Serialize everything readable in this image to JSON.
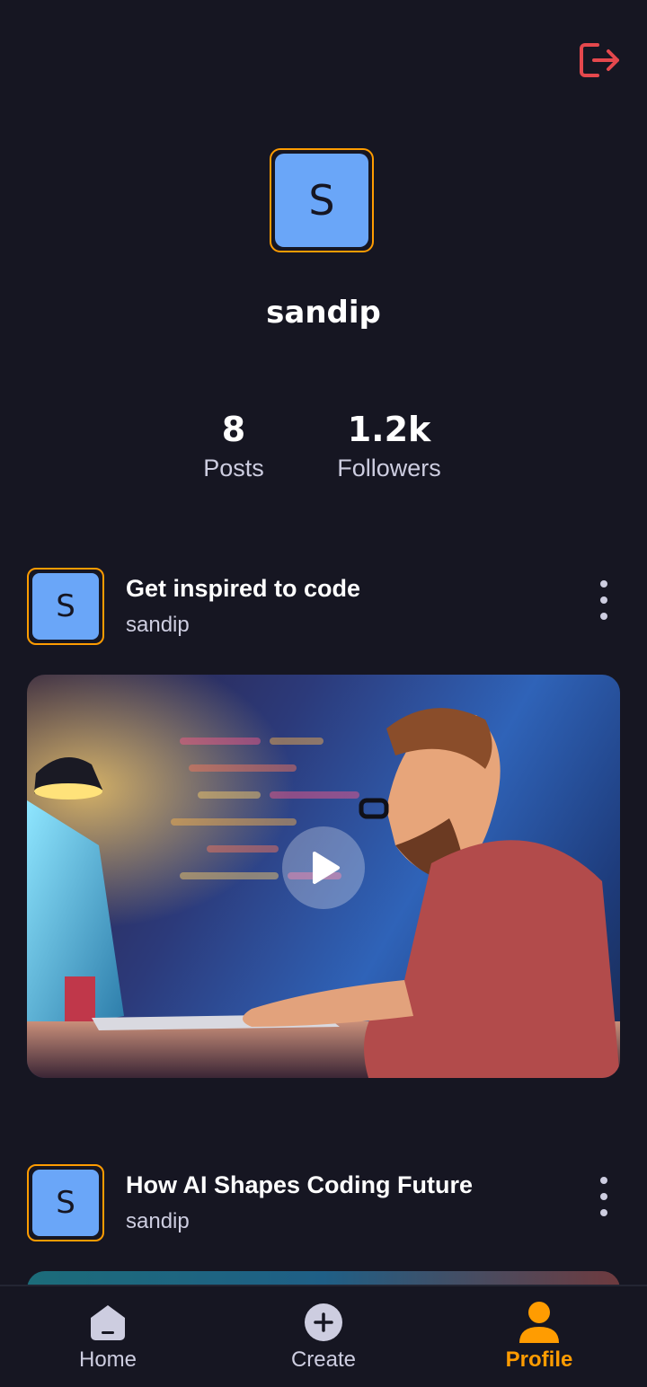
{
  "profile": {
    "avatar_initial": "S",
    "username": "sandip",
    "stats": [
      {
        "value": "8",
        "label": "Posts"
      },
      {
        "value": "1.2k",
        "label": "Followers"
      }
    ],
    "logout_icon": "logout-icon"
  },
  "posts": [
    {
      "avatar_initial": "S",
      "title": "Get inspired to code",
      "author": "sandip"
    },
    {
      "avatar_initial": "S",
      "title": "How AI Shapes Coding Future",
      "author": "sandip"
    }
  ],
  "tabs": [
    {
      "label": "Home",
      "icon": "home-icon"
    },
    {
      "label": "Create",
      "icon": "plus-circle-icon"
    },
    {
      "label": "Profile",
      "icon": "user-icon"
    }
  ],
  "colors": {
    "background": "#161622",
    "accent": "#FF9C01",
    "avatar_bg": "#6AA6F8",
    "logout": "#E5484D",
    "muted_text": "#CDCDE0"
  }
}
